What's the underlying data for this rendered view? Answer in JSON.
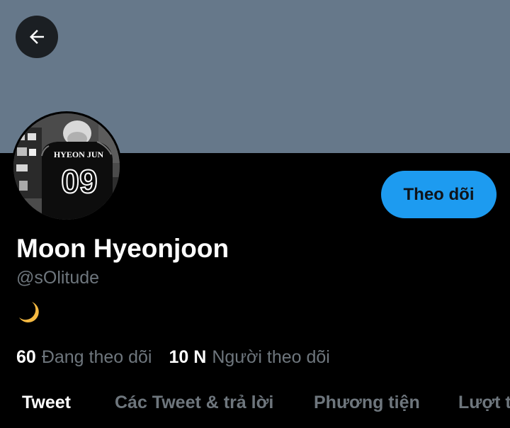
{
  "header": {
    "back_icon": "arrow-left-icon",
    "banner_color": "#66788a"
  },
  "profile": {
    "avatar_jersey_name": "HYEON JUN",
    "avatar_jersey_number": "09",
    "follow_button_label": "Theo dõi",
    "display_name": "Moon Hyeonjoon",
    "handle": "@sOlitude",
    "bio_icon": "crescent-moon-emoji"
  },
  "stats": {
    "following_count": "60",
    "following_label": "Đang theo dõi",
    "followers_count": "10 N",
    "followers_label": "Người theo dõi"
  },
  "tabs": [
    {
      "label": "Tweet",
      "active": true
    },
    {
      "label": "Các Tweet & trả lời",
      "active": false
    },
    {
      "label": "Phương tiện",
      "active": false
    },
    {
      "label": "Lượt thích",
      "active": false
    }
  ],
  "colors": {
    "accent": "#1d9bf0",
    "background": "#000000",
    "secondary_text": "#6e767d"
  }
}
